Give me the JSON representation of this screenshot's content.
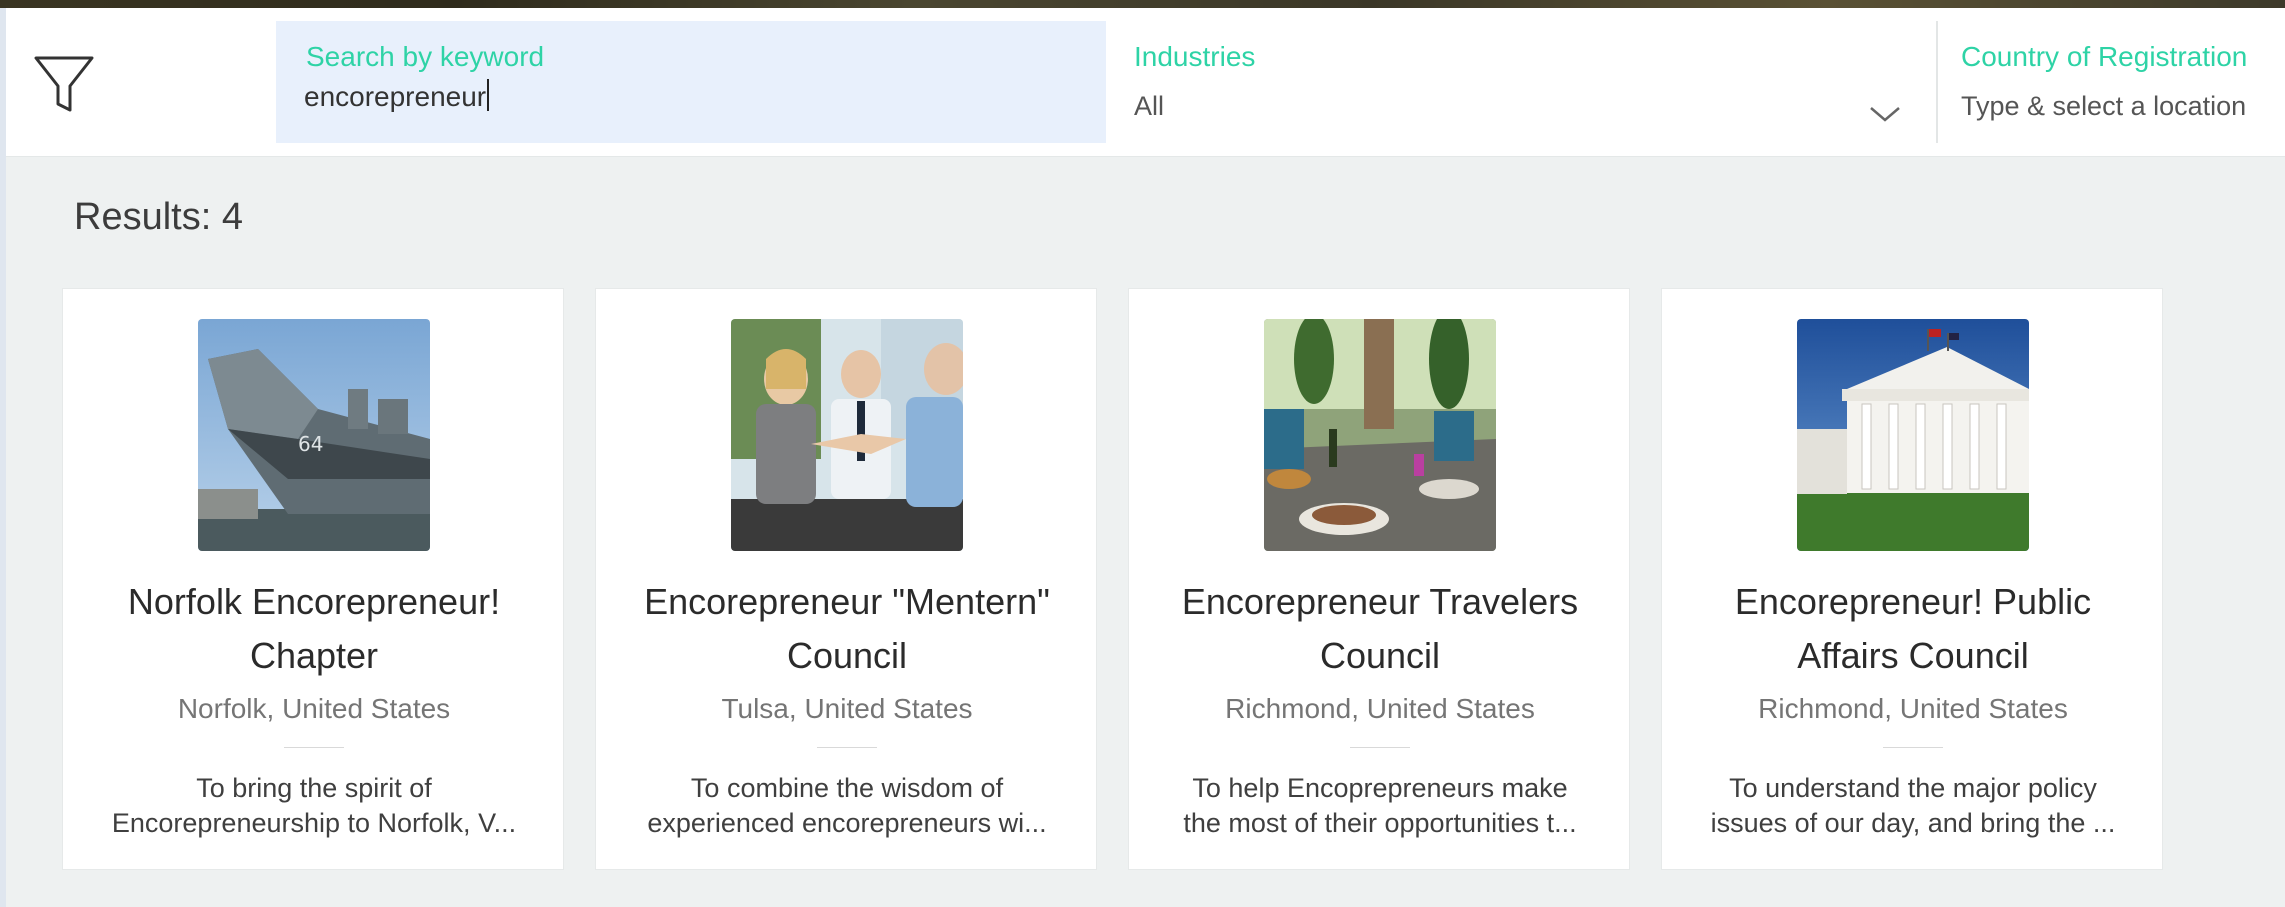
{
  "filters": {
    "search": {
      "label": "Search by keyword",
      "value": "encorepreneur"
    },
    "industries": {
      "label": "Industries",
      "value": "All"
    },
    "country": {
      "label": "Country of Registration",
      "placeholder": "Type & select a location"
    }
  },
  "results": {
    "label": "Results: 4",
    "cards": [
      {
        "title_line1": "Norfolk Encorepreneur!",
        "title_line2": "Chapter",
        "location": "Norfolk, United States",
        "desc_line1": "To bring the spirit of",
        "desc_line2": "Encorepreneurship to Norfolk, V...",
        "image": "battleship-photo"
      },
      {
        "title_line1": "Encorepreneur \"Mentern\"",
        "title_line2": "Council",
        "location": "Tulsa, United States",
        "desc_line1": "To combine the wisdom of",
        "desc_line2": "experienced encorepreneurs wi...",
        "image": "handshake-meeting-photo"
      },
      {
        "title_line1": "Encorepreneur Travelers",
        "title_line2": "Council",
        "location": "Richmond, United States",
        "desc_line1": "To help Encoprepreneurs make",
        "desc_line2": "the most of their opportunities t...",
        "image": "outdoor-dining-table-photo"
      },
      {
        "title_line1": "Encorepreneur! Public",
        "title_line2": "Affairs Council",
        "location": "Richmond, United States",
        "desc_line1": "To understand the major policy",
        "desc_line2": "issues of our day, and bring the ...",
        "image": "capitol-building-photo"
      }
    ]
  },
  "colors": {
    "accent": "#2ed3a6",
    "search_bg": "#e8f0fc",
    "page_bg": "#eef1f1"
  }
}
